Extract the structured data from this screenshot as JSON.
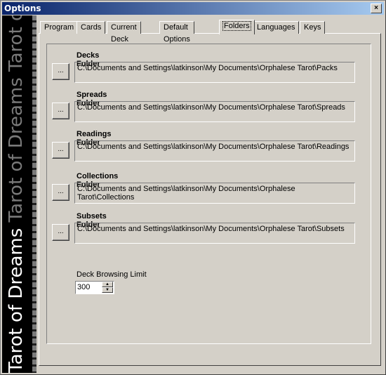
{
  "window": {
    "title": "Options",
    "close_label": "×"
  },
  "banner": {
    "text_bright": "Tarot of Dreams ",
    "text_dim": "Tarot of Dreams Tarot of"
  },
  "tabs": [
    {
      "label": "Program"
    },
    {
      "label": "Cards"
    },
    {
      "label": "Current Deck"
    },
    {
      "label": "Default Options"
    },
    {
      "label": "Folders",
      "active": true
    },
    {
      "label": "Languages"
    },
    {
      "label": "Keys"
    }
  ],
  "folders": [
    {
      "label": "Decks Folder",
      "path": "C:\\Documents and Settings\\latkinson\\My Documents\\Orphalese Tarot\\Packs",
      "button": "..."
    },
    {
      "label": "Spreads Folder",
      "path": "C:\\Documents and Settings\\latkinson\\My Documents\\Orphalese Tarot\\Spreads",
      "button": "..."
    },
    {
      "label": "Readings Folder",
      "path": "C:\\Documents and Settings\\latkinson\\My Documents\\Orphalese Tarot\\Readings",
      "button": "..."
    },
    {
      "label": "Collections Folder",
      "path": "C:\\Documents and Settings\\latkinson\\My Documents\\Orphalese Tarot\\Collections",
      "button": "..."
    },
    {
      "label": "Subsets Folder",
      "path": "C:\\Documents and Settings\\latkinson\\My Documents\\Orphalese Tarot\\Subsets",
      "button": "..."
    }
  ],
  "deck_limit": {
    "label": "Deck Browsing Limit",
    "value": "300",
    "up": "▲",
    "down": "▼"
  }
}
